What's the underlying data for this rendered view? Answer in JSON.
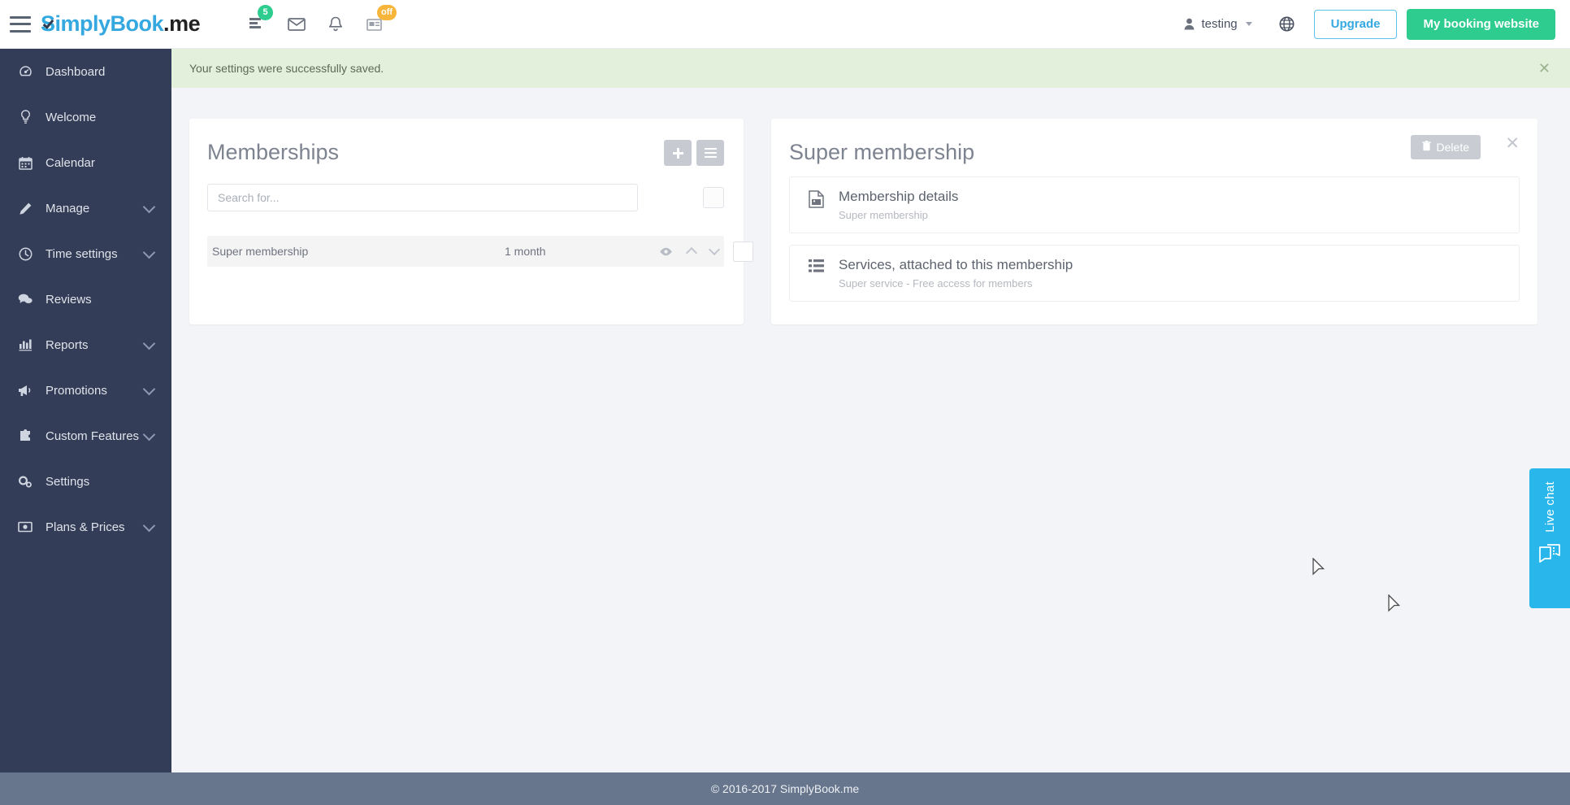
{
  "app": {
    "brand_s": "S",
    "brand_imply": "implyBook",
    "brand_dot": ".",
    "brand_me": "me",
    "menu_icon": "hamburger-icon"
  },
  "header": {
    "nav_icons": [
      {
        "name": "tasks-icon",
        "badge": "5",
        "badge_color": "#2ecc8f"
      },
      {
        "name": "mail-icon",
        "badge": "",
        "badge_color": ""
      },
      {
        "name": "bell-icon",
        "badge": "",
        "badge_color": ""
      },
      {
        "name": "news-icon",
        "badge": "off",
        "badge_color": "#f7b539"
      }
    ],
    "user_name": "testing",
    "user_icon": "person-icon",
    "globe_icon": "globe-icon",
    "upgrade_label": "Upgrade",
    "booking_label": "My booking website",
    "accent_blue": "#35a8e0",
    "accent_green": "#2ecc8f"
  },
  "sidebar": {
    "bg_color": "#343d57",
    "items": [
      {
        "label": "Dashboard",
        "icon": "speedometer-icon",
        "expandable": false
      },
      {
        "label": "Welcome",
        "icon": "lightbulb-icon",
        "expandable": false
      },
      {
        "label": "Calendar",
        "icon": "calendar-icon",
        "expandable": false
      },
      {
        "label": "Manage",
        "icon": "pencil-icon",
        "expandable": true
      },
      {
        "label": "Time settings",
        "icon": "clock-icon",
        "expandable": true
      },
      {
        "label": "Reviews",
        "icon": "comments-icon",
        "expandable": false
      },
      {
        "label": "Reports",
        "icon": "bar-chart-icon",
        "expandable": true
      },
      {
        "label": "Promotions",
        "icon": "megaphone-icon",
        "expandable": true
      },
      {
        "label": "Custom Features",
        "icon": "puzzle-icon",
        "expandable": true
      },
      {
        "label": "Settings",
        "icon": "gears-icon",
        "expandable": false
      },
      {
        "label": "Plans & Prices",
        "icon": "money-icon",
        "expandable": true
      }
    ]
  },
  "alert": {
    "message": "Your settings were successfully saved.",
    "close_icon": "close-icon",
    "bg_color": "#e3f0dc"
  },
  "memberships_panel": {
    "title": "Memberships",
    "add_button_icon": "plus-icon",
    "list_button_icon": "list-icon",
    "search_placeholder": "Search for...",
    "search_value": "",
    "select_all_label": "",
    "columns": [
      "name",
      "duration"
    ],
    "rows": [
      {
        "name": "Super membership",
        "duration": "1 month",
        "preview_icon": "eye-icon",
        "move_up_icon": "chevron-up-icon",
        "move_down_icon": "chevron-down-icon",
        "selected": false
      }
    ]
  },
  "detail_panel": {
    "title": "Super membership",
    "delete_label": "Delete",
    "delete_icon": "trash-icon",
    "close_icon": "close-icon",
    "items": [
      {
        "title": "Membership details",
        "subtitle": "Super membership",
        "icon": "document-image-icon"
      },
      {
        "title": "Services, attached to this membership",
        "subtitle": "Super service - Free access for members",
        "icon": "list-icon"
      }
    ]
  },
  "live_chat": {
    "label": "Live chat",
    "icon": "chat-bubble-icon",
    "bg_color": "#29b6ea"
  },
  "footer": {
    "text": "© 2016-2017 SimplyBook.me",
    "bg_color": "#67758d"
  }
}
